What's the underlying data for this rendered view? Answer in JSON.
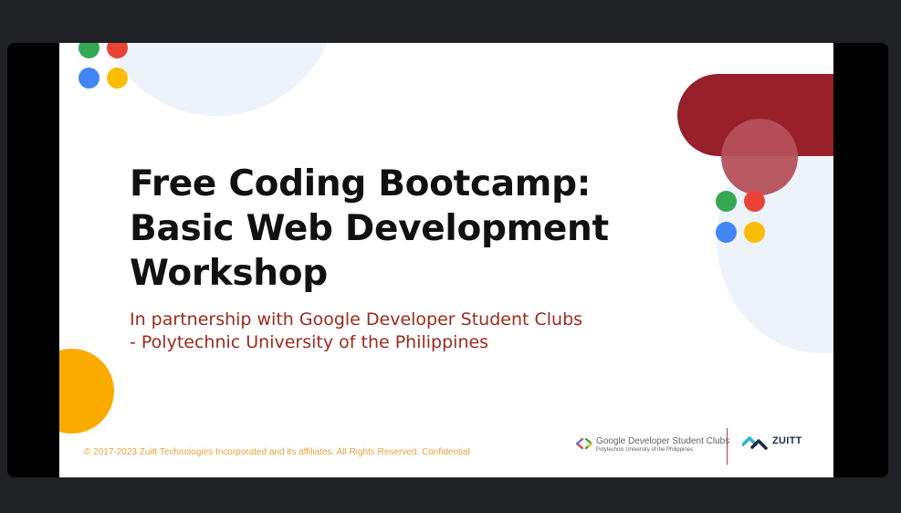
{
  "slide": {
    "title_lines": [
      "Free Coding Bootcamp:",
      "Basic Web Development",
      "Workshop"
    ],
    "subtitle_lines": [
      "In partnership with Google Developer Student Clubs",
      "- Polytechnic University of the Philippines"
    ],
    "copyright": "© 2017-2023 Zuitt Technologies Incorporated and its affiliates. All Rights Reserved. Confidential",
    "gdsc_logo": {
      "name": "Google Developer Student Clubs",
      "sub": "Polytechnic University of the Philippines",
      "icon": "code-brackets-icon"
    },
    "zuitt_logo": {
      "name": "ZUITT",
      "icon": "zuitt-icon"
    }
  },
  "colors": {
    "google_green": "#34a853",
    "google_red": "#ea4335",
    "google_blue": "#4285f4",
    "google_yellow": "#fbbc04",
    "brand_maroon": "#97202a",
    "accent_orange": "#fbab00",
    "subtitle_red": "#9b2a1e",
    "meeting_background": "#202124"
  }
}
